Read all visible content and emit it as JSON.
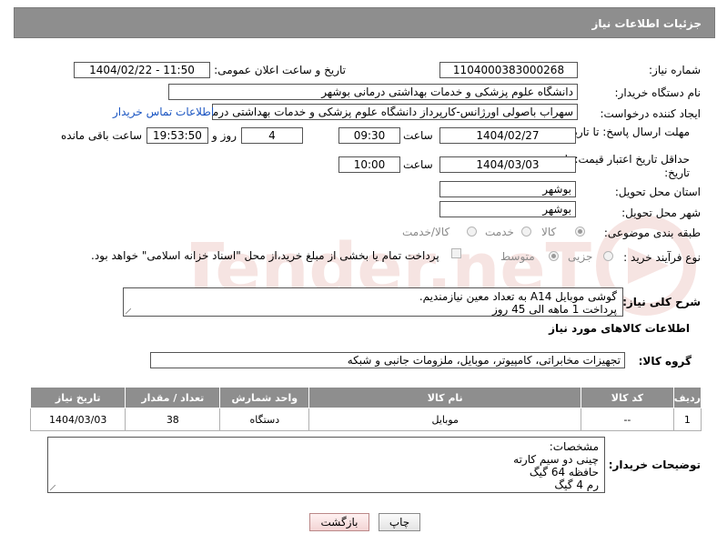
{
  "header": {
    "title": "جزئیات اطلاعات نیاز"
  },
  "fields": {
    "need_number_label": "شماره نیاز:",
    "need_number": "1104000383000268",
    "announce_label": "تاریخ و ساعت اعلان عمومی:",
    "announce_value": "1404/02/22 - 11:50",
    "buyer_org_label": "نام دستگاه خریدار:",
    "buyer_org": "دانشگاه علوم پزشکی و خدمات بهداشتی درمانی بوشهر",
    "requester_label": "ایجاد کننده درخواست:",
    "requester": "سهراب باصولی اورژانس-کارپرداز دانشگاه علوم پزشکی و خدمات بهداشتی درمانی بوشهر",
    "contact_link": "اطلاعات تماس خریدار",
    "reply_deadline_label": "مهلت ارسال پاسخ: تا تاریخ:",
    "reply_date": "1404/02/27",
    "time_word": "ساعت",
    "reply_time": "09:30",
    "days_value": "4",
    "days_and": "روز و",
    "remaining_time": "19:53:50",
    "remaining_label": "ساعت باقی مانده",
    "price_validity_label": "حداقل تاریخ اعتبار قیمت: تا تاریخ:",
    "price_date": "1404/03/03",
    "price_time": "10:00",
    "province_label": "استان محل تحویل:",
    "province": "بوشهر",
    "city_label": "شهر محل تحویل:",
    "city": "بوشهر",
    "category_label": "طبقه بندی موضوعی:",
    "category_options": [
      "کالا",
      "خدمت",
      "کالا/خدمت"
    ],
    "process_label": "نوع فرآیند خرید :",
    "process_options": [
      "جزیی",
      "متوسط"
    ],
    "payment_note": "پرداخت تمام یا بخشی از مبلغ خرید،از محل \"اسناد خزانه اسلامی\" خواهد بود.",
    "summary_label": "شرح کلی نیاز:",
    "summary_lines": [
      "گوشی موبایل A14 به تعداد معین نیازمندیم.",
      "پرداخت 1 ماهه الی 45 روز"
    ],
    "goods_info_title": "اطلاعات کالاهای مورد نیاز",
    "goods_group_label": "گروه کالا:",
    "goods_group": "تجهیزات مخابراتی، کامپیوتر، موبایل، ملزومات جانبی و شبکه",
    "buyer_notes_label": "توضیحات خریدار:",
    "buyer_notes_lines": [
      "مشخصات:",
      "چینی دو سیم کارته",
      "حافظه 64 گیگ",
      "رم 4 گیگ"
    ]
  },
  "table": {
    "headers": [
      "ردیف",
      "کد کالا",
      "نام کالا",
      "واحد شمارش",
      "تعداد / مقدار",
      "تاریخ نیاز"
    ],
    "rows": [
      {
        "row": "1",
        "code": "--",
        "name": "موبایل",
        "unit": "دستگاه",
        "qty": "38",
        "date": "1404/03/03"
      }
    ]
  },
  "buttons": {
    "print": "چاپ",
    "back": "بازگشت"
  },
  "watermark": {
    "text": "AriaTender.neT"
  },
  "colors": {
    "header_bg": "#8e8e8e",
    "link": "#1a55c2",
    "watermark": "#c0392b"
  }
}
